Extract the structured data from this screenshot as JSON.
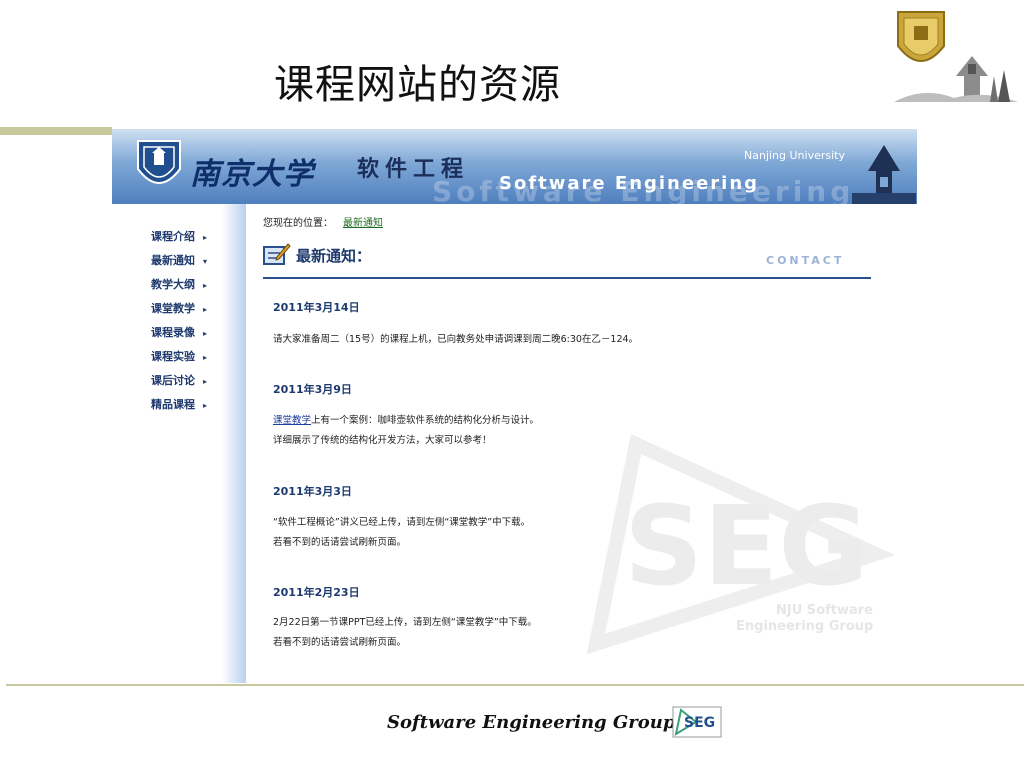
{
  "slide": {
    "title": "课程网站的资源",
    "footer": "Software Engineering Group",
    "footer_logo": "SEG"
  },
  "banner": {
    "university_cn": "南京大学",
    "course_cn": "软件工程",
    "course_en": "Software Engineering",
    "course_en_ghost": "Software Engineering",
    "university_en": "Nanjing University"
  },
  "sidebar": {
    "items": [
      {
        "label": "课程介绍",
        "arrow": "▸"
      },
      {
        "label": "最新通知",
        "arrow": "▾"
      },
      {
        "label": "教学大纲",
        "arrow": "▸"
      },
      {
        "label": "课堂教学",
        "arrow": "▸"
      },
      {
        "label": "课程录像",
        "arrow": "▸"
      },
      {
        "label": "课程实验",
        "arrow": "▸"
      },
      {
        "label": "课后讨论",
        "arrow": "▸"
      },
      {
        "label": "精品课程",
        "arrow": "▸"
      }
    ]
  },
  "main": {
    "location_label": "您现在的位置：",
    "location_link": "最新通知",
    "section_title": "最新通知：",
    "contact_label": "CONTACT",
    "notices": [
      {
        "date": "2011年3月14日",
        "lines": [
          {
            "link": "",
            "text": "请大家准备周二（15号）的课程上机，已向教务处申请调课到周二晚6:30在乙－124。"
          }
        ]
      },
      {
        "date": "2011年3月9日",
        "lines": [
          {
            "link": "课堂教学",
            "text": "上有一个案例：咖啡壶软件系统的结构化分析与设计。"
          },
          {
            "link": "",
            "text": "详细展示了传统的结构化开发方法，大家可以参考！"
          }
        ]
      },
      {
        "date": "2011年3月3日",
        "lines": [
          {
            "link": "",
            "text": "“软件工程概论”讲义已经上传，请到左侧“课堂教学”中下载。"
          },
          {
            "link": "",
            "text": "若看不到的话请尝试刷新页面。"
          }
        ]
      },
      {
        "date": "2011年2月23日",
        "lines": [
          {
            "link": "",
            "text": "2月22日第一节课PPT已经上传，请到左侧“课堂教学”中下载。"
          },
          {
            "link": "",
            "text": "若看不到的话请尝试刷新页面。"
          }
        ]
      }
    ]
  },
  "watermark": {
    "logo": "SEG",
    "line1": "NJU Software",
    "line2": "Engineering Group"
  },
  "colors": {
    "banner_dark": "#4f7fbe",
    "nav_text": "#1e3a6e",
    "rule_olive": "#c9c79c",
    "link_green": "#1f6b1f",
    "link_blue": "#1f3f9c"
  }
}
